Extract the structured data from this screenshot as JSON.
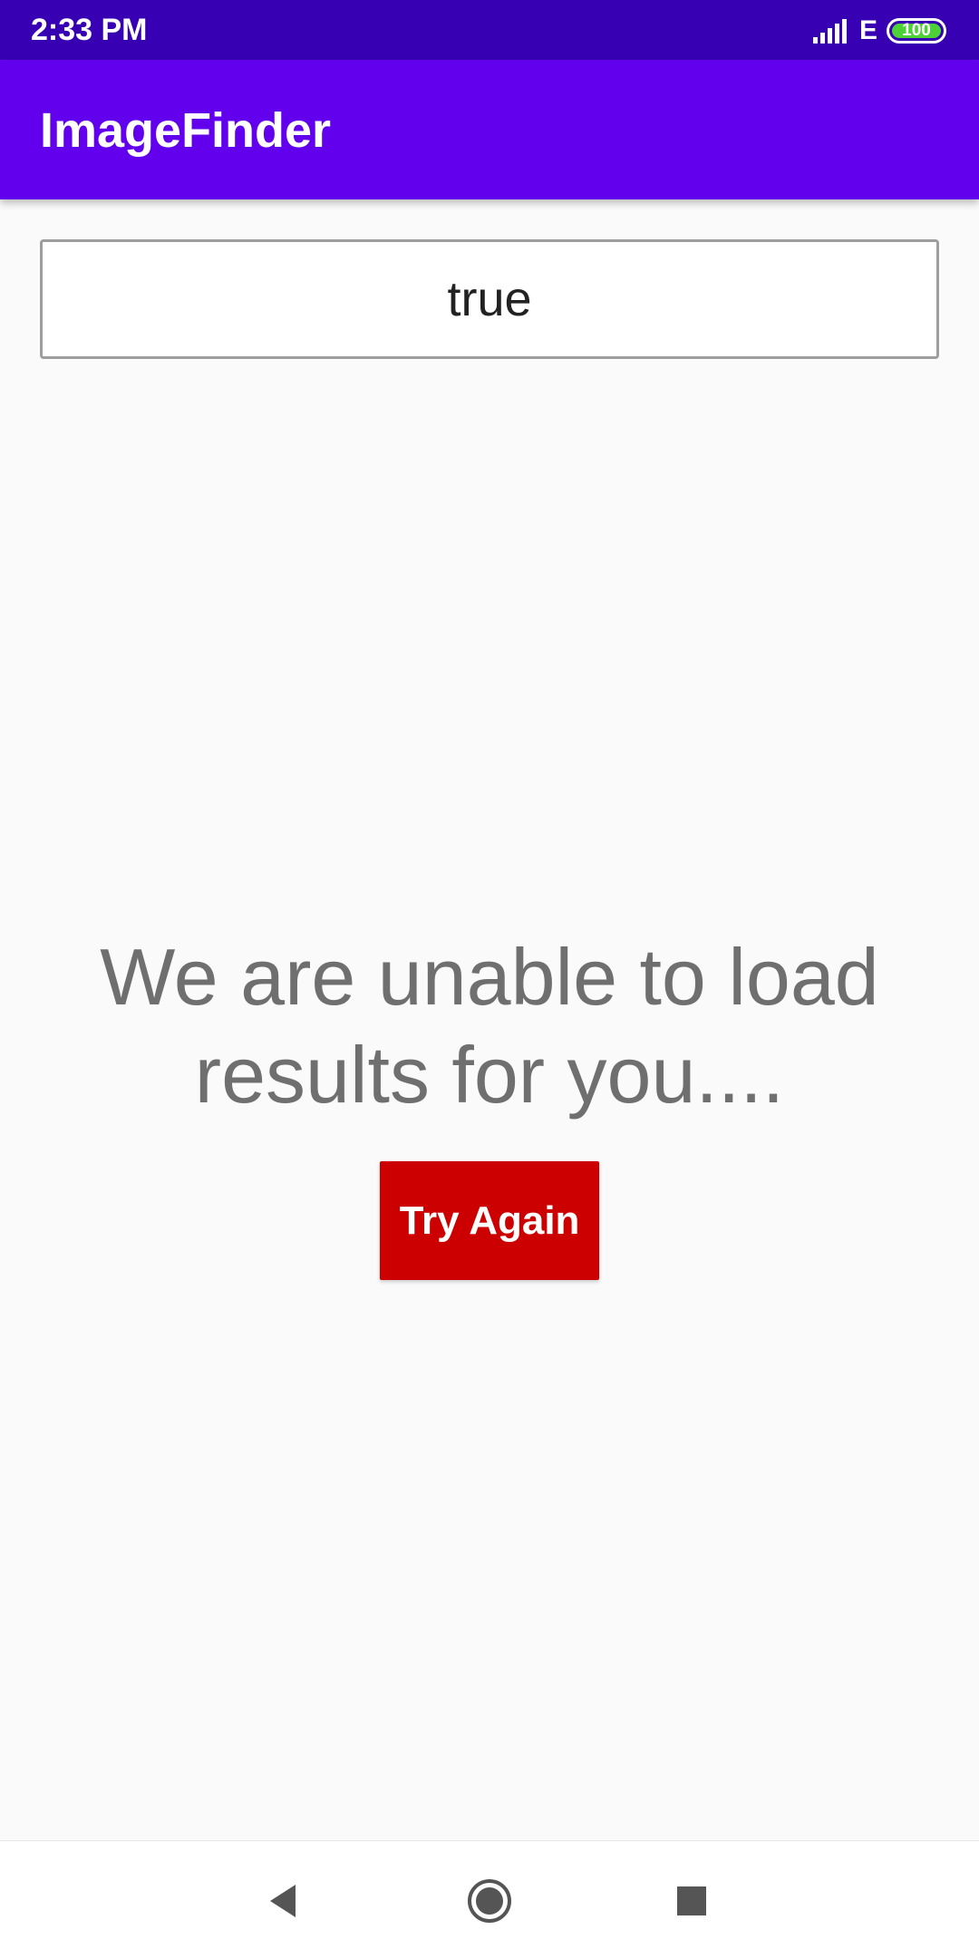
{
  "status_bar": {
    "time": "2:33 PM",
    "network_type": "E",
    "battery_level": "100",
    "signal_icon": "signal-bars-icon",
    "battery_icon": "battery-icon",
    "battery_color": "#4cd137",
    "background_color": "#3700b3"
  },
  "app_bar": {
    "title": "ImageFinder",
    "background_color": "#6200ee"
  },
  "search": {
    "value": "true",
    "placeholder": ""
  },
  "error": {
    "message": "We are unable to load results for you....",
    "text_color": "#6f6f6f"
  },
  "retry_button": {
    "label": "Try Again",
    "background_color": "#cc0000"
  },
  "nav_bar": {
    "back_icon": "back-triangle-icon",
    "home_icon": "home-circle-icon",
    "recents_icon": "recents-square-icon"
  }
}
